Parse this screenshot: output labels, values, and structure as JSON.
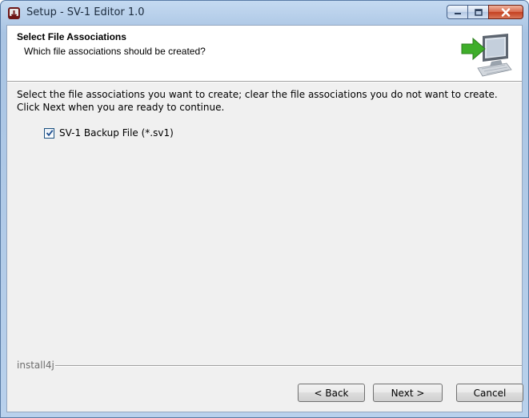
{
  "window": {
    "title": "Setup - SV-1 Editor 1.0"
  },
  "header": {
    "title": "Select File Associations",
    "subtitle": "Which file associations should be created?"
  },
  "content": {
    "description": "Select the file associations you want to create; clear the file associations you do not want to create. Click Next when you are ready to continue.",
    "checkboxes": [
      {
        "label": "SV-1 Backup File (*.sv1)",
        "checked": true
      }
    ]
  },
  "footer": {
    "brand": "install4j",
    "back_label": "< Back",
    "next_label": "Next >",
    "cancel_label": "Cancel"
  },
  "icons": {
    "app": "setup-app-icon",
    "header": "computer-arrow-icon",
    "minimize": "minimize-icon",
    "maximize": "maximize-icon",
    "close": "close-icon",
    "check": "checkmark-icon"
  },
  "colors": {
    "titlebar": "#b7cfea",
    "close_button": "#c4401f",
    "header_bg": "#ffffff",
    "client_bg": "#f0f0f0",
    "arrow_green": "#3fae2a"
  }
}
